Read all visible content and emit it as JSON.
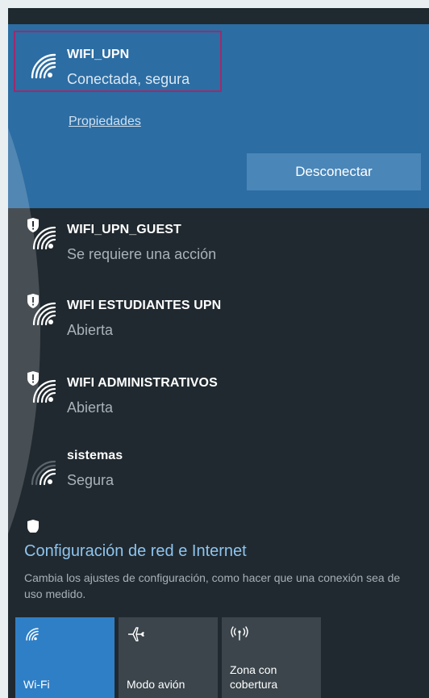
{
  "connected_network": {
    "name": "WIFI_UPN",
    "status": "Conectada, segura",
    "properties_link": "Propiedades",
    "disconnect_label": "Desconectar"
  },
  "networks": [
    {
      "name": "WIFI_UPN_GUEST",
      "status": "Se requiere una acción",
      "shield": true
    },
    {
      "name": "WIFI ESTUDIANTES UPN",
      "status": "Abierta",
      "shield": true
    },
    {
      "name": "WIFI ADMINISTRATIVOS",
      "status": "Abierta",
      "shield": true
    },
    {
      "name": "sistemas",
      "status": "Segura",
      "shield": false
    }
  ],
  "settings": {
    "title": "Configuración de red e Internet",
    "description": "Cambia los ajustes de configuración, como hacer que una conexión sea de uso medido."
  },
  "quick_actions": [
    {
      "label": "Wi-Fi",
      "icon": "wifi-icon",
      "active": true
    },
    {
      "label": "Modo avión",
      "icon": "airplane-icon",
      "active": false
    },
    {
      "label": "Zona con cobertura",
      "label_line1": "Zona con",
      "label_line2": "cobertura",
      "icon": "hotspot-icon",
      "active": false
    }
  ],
  "colors": {
    "panel_bg": "#20292f",
    "connected_bg": "#2c6da3",
    "accent": "#2f7fc6",
    "highlight_border": "#9c2b6c"
  }
}
